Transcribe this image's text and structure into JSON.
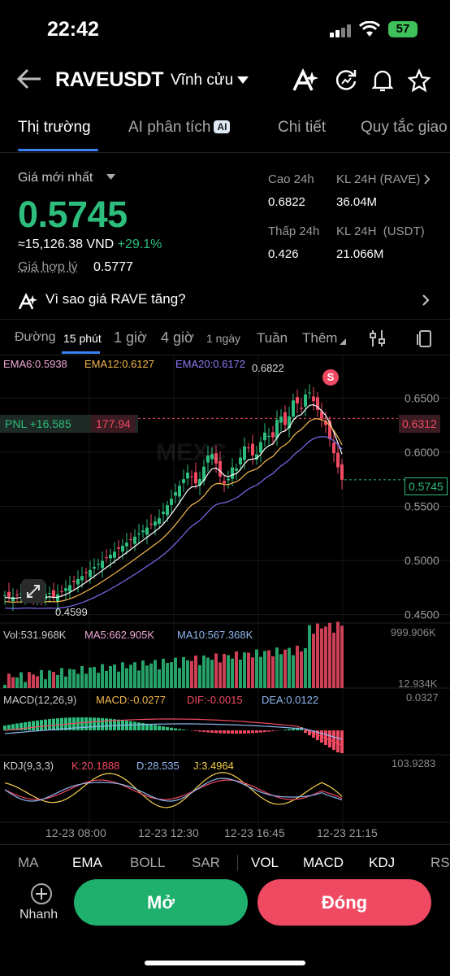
{
  "status_bar": {
    "time": "22:42",
    "battery": "57"
  },
  "header": {
    "symbol": "RAVEUSDT",
    "contract_type": "Vĩnh cửu"
  },
  "tabs": [
    {
      "label": "Thị trường",
      "active": true
    },
    {
      "label": "AI phân tích",
      "badge": "AI",
      "active": false
    },
    {
      "label": "Chi tiết",
      "active": false
    },
    {
      "label": "Quy tắc giao",
      "active": false
    }
  ],
  "price_panel": {
    "last_price_label": "Giá mới nhất",
    "last_price": "0.5745",
    "vnd_value": "≈15,126.38",
    "currency": "VND",
    "change_pct": "+29.1%",
    "fair_price_label": "Giá hợp lý",
    "fair_price": "0.5777",
    "high_label": "Cao 24h",
    "high": "0.6822",
    "low_label": "Thấp 24h",
    "low": "0.426",
    "vol_rave_label": "KL 24H (RAVE)",
    "vol_rave": "36.04M",
    "vol_usdt_label": "KL 24H  (USDT)",
    "vol_usdt": "21.066M"
  },
  "reason_text": "Vì sao giá RAVE tăng?",
  "intervals": [
    "Đường",
    "15 phút",
    "1 giờ",
    "4 giờ",
    "1 ngày",
    "Tuần",
    "Thêm"
  ],
  "active_interval": "15 phút",
  "chart_overlay": {
    "ema6": "EMA6:0.5938",
    "ema12": "EMA12:0.6127",
    "ema20": "EMA20:0.6172",
    "pnl_label": "PNL +16.585",
    "pnl_price": "177.94",
    "max_label": "0.6822",
    "min_label": "0.4599",
    "marker": "S",
    "pnl_line_value": "0.6312",
    "current_value": "0.5745",
    "vol": "Vol:531.968K",
    "ma5": "MA5:662.905K",
    "ma10": "MA10:567.368K",
    "vol_max": "999.906K",
    "vol_min": "12.934K",
    "macd_params": "MACD(12,26,9)",
    "macd": "MACD:-0.0277",
    "dif": "DIF:-0.0015",
    "dea": "DEA:0.0122",
    "macd_top": "0.0327",
    "kdj_params": "KDJ(9,3,3)",
    "k": "K:20.1888",
    "d": "D:28.535",
    "j": "J:3.4964",
    "kdj_top": "103.9283",
    "watermark": "MEXC"
  },
  "chart_data": {
    "type": "candlestick",
    "y_ticks": [
      "0.6500",
      "0.6000",
      "0.5500",
      "0.5000",
      "0.4500"
    ],
    "x_ticks": [
      "12-23 08:00",
      "12-23 12:30",
      "12-23 16:45",
      "12-23 21:15"
    ],
    "high": 0.6822,
    "low": 0.4599,
    "last": 0.5745,
    "colors": {
      "up": "#2dbd7c",
      "down": "#f04a63",
      "ema6": "#ffffff",
      "ema12": "#f5b84e",
      "ema20": "#7b6cf0"
    }
  },
  "indicator_tabs": [
    "MA",
    "EMA",
    "BOLL",
    "SAR",
    "VOL",
    "MACD",
    "KDJ",
    "RSI"
  ],
  "active_indicators": [
    "EMA",
    "VOL",
    "MACD",
    "KDJ"
  ],
  "bottom": {
    "quick_label": "Nhanh",
    "open_label": "Mở",
    "close_label": "Đóng"
  }
}
